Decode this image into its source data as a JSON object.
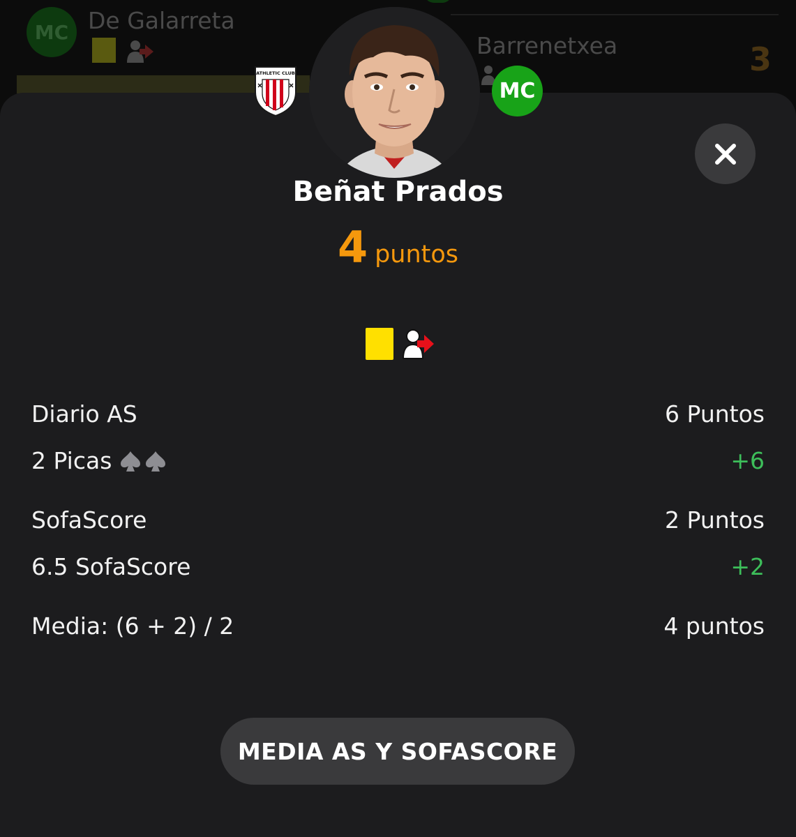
{
  "background_list": {
    "left_player": {
      "position": "MC",
      "name": "De Galarreta"
    },
    "right_player": {
      "name": "Barrenetxea",
      "points": "3"
    }
  },
  "player": {
    "name": "Beñat Prados",
    "points_value": "4",
    "points_unit": "puntos",
    "position_badge": "MC",
    "club": "Athletic Club Bilbao"
  },
  "events": [
    "yellow-card",
    "substitution-out-icon"
  ],
  "breakdown": [
    {
      "label": "Diario AS",
      "value": "6 Puntos"
    },
    {
      "label": "2 Picas",
      "value": "+6"
    },
    {
      "label": "SofaScore",
      "value": "2 Puntos"
    },
    {
      "label": "6.5 SofaScore",
      "value": "+2"
    },
    {
      "label": "Media: (6 + 2) / 2",
      "value": "4 puntos"
    }
  ],
  "bottom_button": {
    "label": "MEDIA AS Y SOFASCORE"
  },
  "colors": {
    "accent_points": "#f5980d",
    "positive": "#3dbe5a",
    "badge_green": "#18a318",
    "sheet": "#1c1c1e",
    "yellow_card": "#ffe000"
  }
}
